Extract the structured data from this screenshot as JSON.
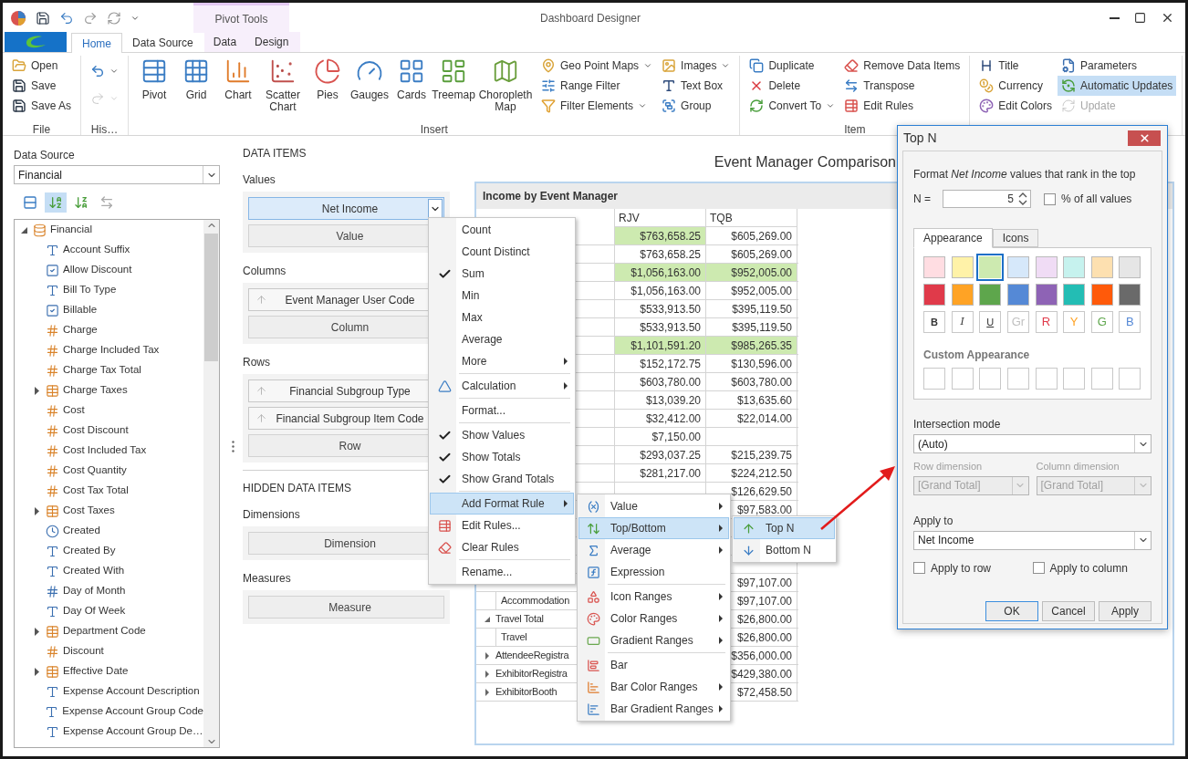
{
  "window": {
    "title": "Dashboard Designer",
    "context_tab_group": "Pivot Tools"
  },
  "ribbon_tabs": [
    {
      "label": "Home",
      "selected": true,
      "contextual": false
    },
    {
      "label": "Data Source",
      "selected": false,
      "contextual": false
    },
    {
      "label": "Data",
      "selected": false,
      "contextual": true
    },
    {
      "label": "Design",
      "selected": false,
      "contextual": true
    }
  ],
  "ribbon_groups": [
    {
      "label": "File",
      "columns": [
        [
          {
            "label": "Open"
          },
          {
            "label": "Save"
          },
          {
            "label": "Save As"
          }
        ]
      ]
    },
    {
      "label": "His…",
      "columns": [
        [
          {
            "dropdown": true,
            "disabled": false
          },
          {
            "dropdown": true,
            "disabled": true
          }
        ]
      ]
    },
    {
      "label": "Insert",
      "large": [
        "Pivot",
        "Grid",
        "Chart",
        "Scatter Chart",
        "Pies",
        "Gauges",
        "Cards",
        "Treemap",
        "Choropleth Map"
      ],
      "columns": [
        [
          {
            "label": "Geo Point Maps",
            "dropdown": true
          },
          {
            "label": "Range Filter"
          },
          {
            "label": "Filter Elements",
            "dropdown": true
          }
        ],
        [
          {
            "label": "Images",
            "dropdown": true
          },
          {
            "label": "Text Box"
          },
          {
            "label": "Group"
          }
        ]
      ]
    },
    {
      "label": "Item",
      "columns": [
        [
          {
            "label": "Duplicate"
          },
          {
            "label": "Delete"
          },
          {
            "label": "Convert To",
            "dropdown": true
          }
        ],
        [
          {
            "label": "Remove Data Items"
          },
          {
            "label": "Transpose"
          },
          {
            "label": "Edit Rules"
          }
        ]
      ]
    },
    {
      "columns": [
        [
          {
            "label": "Title",
            "selected": false,
            "disabled": false
          },
          {
            "label": "Currency",
            "selected": false,
            "disabled": false
          },
          {
            "label": "Edit Colors",
            "selected": false,
            "disabled": false
          }
        ],
        [
          {
            "label": "Parameters",
            "selected": false,
            "disabled": false
          },
          {
            "label": "Automatic Updates",
            "selected": true,
            "disabled": false
          },
          {
            "label": "Update",
            "selected": false,
            "disabled": true
          }
        ]
      ]
    }
  ],
  "fields": {
    "label": "Data Source",
    "source": "Financial",
    "toolbar": [
      {
        "selected": false,
        "disabled": false
      },
      {
        "selected": true,
        "disabled": false
      },
      {
        "selected": false,
        "disabled": false
      },
      {
        "selected": false,
        "disabled": true
      }
    ],
    "tree": [
      {
        "label": "Financial",
        "kind": "source",
        "expanded": true,
        "children": [
          {
            "label": "Account Suffix",
            "kind": "text"
          },
          {
            "label": "Allow Discount",
            "kind": "bool"
          },
          {
            "label": "Bill To Type",
            "kind": "text"
          },
          {
            "label": "Billable",
            "kind": "bool"
          },
          {
            "label": "Charge",
            "kind": "number"
          },
          {
            "label": "Charge Included Tax",
            "kind": "number"
          },
          {
            "label": "Charge Tax Total",
            "kind": "number"
          },
          {
            "label": "Charge Taxes",
            "kind": "table",
            "expanded": false
          },
          {
            "label": "Cost",
            "kind": "number"
          },
          {
            "label": "Cost Discount",
            "kind": "number"
          },
          {
            "label": "Cost Included Tax",
            "kind": "number"
          },
          {
            "label": "Cost Quantity",
            "kind": "number"
          },
          {
            "label": "Cost Tax Total",
            "kind": "number"
          },
          {
            "label": "Cost Taxes",
            "kind": "table",
            "expanded": false
          },
          {
            "label": "Created",
            "kind": "date"
          },
          {
            "label": "Created By",
            "kind": "text"
          },
          {
            "label": "Created With",
            "kind": "text"
          },
          {
            "label": "Day of Month",
            "kind": "integer"
          },
          {
            "label": "Day Of Week",
            "kind": "text"
          },
          {
            "label": "Department Code",
            "kind": "table",
            "expanded": false
          },
          {
            "label": "Discount",
            "kind": "number"
          },
          {
            "label": "Effective Date",
            "kind": "table",
            "expanded": false
          },
          {
            "label": "Expense Account Description",
            "kind": "text"
          },
          {
            "label": "Expense Account Group Code",
            "kind": "text"
          },
          {
            "label": "Expense Account Group De…",
            "kind": "text"
          }
        ]
      }
    ]
  },
  "data_items": {
    "title": "DATA ITEMS",
    "sections": [
      {
        "label": "Values",
        "items": [
          {
            "label": "Net Income",
            "kind": "measure",
            "selected": true
          },
          {
            "label": "Value",
            "kind": "placeholder"
          }
        ]
      },
      {
        "label": "Columns",
        "items": [
          {
            "label": "Event Manager User Code",
            "kind": "dimension",
            "selected": false
          },
          {
            "label": "Column",
            "kind": "placeholder"
          }
        ]
      },
      {
        "label": "Rows",
        "items": [
          {
            "label": "Financial Subgroup Type",
            "kind": "dimension",
            "selected": false
          },
          {
            "label": "Financial Subgroup Item Code",
            "kind": "dimension",
            "selected": false
          },
          {
            "label": "Row",
            "kind": "placeholder"
          }
        ]
      }
    ]
  },
  "hidden_data_items": {
    "title": "HIDDEN DATA ITEMS",
    "sections": [
      {
        "label": "Dimensions",
        "items": [
          {
            "label": "Dimension",
            "kind": "placeholder"
          }
        ]
      },
      {
        "label": "Measures",
        "items": [
          {
            "label": "Measure",
            "kind": "placeholder"
          }
        ]
      }
    ]
  },
  "dashboard": {
    "title": "Event Manager Comparison",
    "pivot": {
      "title": "Income by Event Manager",
      "columns": [
        "RJV",
        "TQB"
      ],
      "rows": [
        {
          "cells": [
            {
              "text": "$763,658.25",
              "highlighted": true
            },
            {
              "text": "$605,269.00",
              "highlighted": false
            }
          ]
        },
        {
          "cells": [
            {
              "text": "$763,658.25",
              "highlighted": false
            },
            {
              "text": "$605,269.00",
              "highlighted": false
            }
          ]
        },
        {
          "cells": [
            {
              "text": "$1,056,163.00",
              "highlighted": true
            },
            {
              "text": "$952,005.00",
              "highlighted": true
            }
          ]
        },
        {
          "cells": [
            {
              "text": "$1,056,163.00",
              "highlighted": false
            },
            {
              "text": "$952,005.00",
              "highlighted": false
            }
          ]
        },
        {
          "cells": [
            {
              "text": "$533,913.50",
              "highlighted": false
            },
            {
              "text": "$395,119.50",
              "highlighted": false
            }
          ]
        },
        {
          "cells": [
            {
              "text": "$533,913.50",
              "highlighted": false
            },
            {
              "text": "$395,119.50",
              "highlighted": false
            }
          ]
        },
        {
          "cells": [
            {
              "text": "$1,101,591.20",
              "highlighted": true
            },
            {
              "text": "$985,265.35",
              "highlighted": true
            }
          ]
        },
        {
          "cells": [
            {
              "text": "$152,172.75",
              "highlighted": false
            },
            {
              "text": "$130,596.00",
              "highlighted": false
            }
          ]
        },
        {
          "cells": [
            {
              "text": "$603,780.00",
              "highlighted": false
            },
            {
              "text": "$603,780.00",
              "highlighted": false
            }
          ]
        },
        {
          "cells": [
            {
              "text": "$13,039.20",
              "highlighted": false
            },
            {
              "text": "$13,635.60",
              "highlighted": false
            }
          ]
        },
        {
          "cells": [
            {
              "text": "$32,412.00",
              "highlighted": false
            },
            {
              "text": "$22,014.00",
              "highlighted": false
            }
          ]
        },
        {
          "cells": [
            {
              "text": "$7,150.00",
              "highlighted": false
            },
            null
          ]
        },
        {
          "cells": [
            {
              "text": "$293,037.25",
              "highlighted": false
            },
            {
              "text": "$215,239.75",
              "highlighted": false
            }
          ]
        },
        {
          "cells": [
            {
              "text": "$281,217.00",
              "highlighted": false
            },
            {
              "text": "$224,212.50",
              "highlighted": false
            }
          ]
        },
        {
          "cells": [
            null,
            {
              "text": "$126,629.50",
              "highlighted": false
            }
          ]
        },
        {
          "cells": [
            null,
            {
              "text": "$97,583.00",
              "highlighted": false
            }
          ]
        },
        {
          "cells": [
            null,
            null
          ]
        },
        {
          "cells": [
            null,
            null
          ]
        },
        {
          "cells": [
            null,
            null
          ]
        },
        {
          "cells": [
            null,
            {
              "text": "$97,107.00",
              "highlighted": false
            }
          ]
        },
        {
          "label": "Accommodation",
          "kind": "child",
          "cells": [
            null,
            {
              "text": "$97,107.00",
              "highlighted": false
            }
          ]
        },
        {
          "label": "Travel Total",
          "kind": "expanded",
          "cells": [
            null,
            {
              "text": "$26,800.00",
              "highlighted": false
            }
          ]
        },
        {
          "label": "Travel",
          "kind": "child",
          "cells": [
            null,
            {
              "text": "$26,800.00",
              "highlighted": false
            }
          ]
        },
        {
          "label": "AttendeeRegistra",
          "kind": "collapsed",
          "cells": [
            null,
            {
              "text": "$356,000.00",
              "highlighted": false
            }
          ]
        },
        {
          "label": "ExhibitorRegistra",
          "kind": "collapsed",
          "cells": [
            null,
            {
              "text": "$429,380.00",
              "highlighted": false
            }
          ]
        },
        {
          "label": "ExhibitorBooth",
          "kind": "collapsed",
          "cells": [
            null,
            {
              "text": "$72,458.50",
              "highlighted": false
            }
          ]
        }
      ]
    }
  },
  "menus": [
    {
      "items": [
        {
          "kind": "item",
          "label": "Count",
          "checked": false,
          "submenu": false,
          "selected": false
        },
        {
          "kind": "item",
          "label": "Count Distinct",
          "checked": false,
          "submenu": false,
          "selected": false
        },
        {
          "kind": "item",
          "label": "Sum",
          "checked": true,
          "submenu": false,
          "selected": false
        },
        {
          "kind": "item",
          "label": "Min",
          "checked": false,
          "submenu": false,
          "selected": false
        },
        {
          "kind": "item",
          "label": "Max",
          "checked": false,
          "submenu": false,
          "selected": false
        },
        {
          "kind": "item",
          "label": "Average",
          "checked": false,
          "submenu": false,
          "selected": false
        },
        {
          "kind": "item",
          "label": "More",
          "checked": false,
          "submenu": true,
          "selected": false
        },
        {
          "kind": "separator"
        },
        {
          "kind": "item",
          "label": "Calculation",
          "checked": false,
          "submenu": true,
          "selected": false
        },
        {
          "kind": "separator"
        },
        {
          "kind": "item",
          "label": "Format...",
          "checked": false,
          "submenu": false,
          "selected": false
        },
        {
          "kind": "separator"
        },
        {
          "kind": "item",
          "label": "Show Values",
          "checked": true,
          "submenu": false,
          "selected": false
        },
        {
          "kind": "item",
          "label": "Show Totals",
          "checked": true,
          "submenu": false,
          "selected": false
        },
        {
          "kind": "item",
          "label": "Show Grand Totals",
          "checked": true,
          "submenu": false,
          "selected": false
        },
        {
          "kind": "separator"
        },
        {
          "kind": "item",
          "label": "Add Format Rule",
          "checked": false,
          "submenu": true,
          "selected": true
        },
        {
          "kind": "item",
          "label": "Edit Rules...",
          "checked": false,
          "submenu": false,
          "selected": false
        },
        {
          "kind": "item",
          "label": "Clear Rules",
          "checked": false,
          "submenu": false,
          "selected": false
        },
        {
          "kind": "separator"
        },
        {
          "kind": "item",
          "label": "Rename...",
          "checked": false,
          "submenu": false,
          "selected": false
        }
      ]
    },
    {
      "items": [
        {
          "kind": "item",
          "label": "Value",
          "submenu": true,
          "selected": false
        },
        {
          "kind": "item",
          "label": "Top/Bottom",
          "submenu": true,
          "selected": true
        },
        {
          "kind": "item",
          "label": "Average",
          "submenu": true,
          "selected": false
        },
        {
          "kind": "item",
          "label": "Expression",
          "submenu": false,
          "selected": false
        },
        {
          "kind": "separator"
        },
        {
          "kind": "item",
          "label": "Icon Ranges",
          "submenu": true,
          "selected": false
        },
        {
          "kind": "item",
          "label": "Color Ranges",
          "submenu": true,
          "selected": false
        },
        {
          "kind": "item",
          "label": "Gradient Ranges",
          "submenu": true,
          "selected": false
        },
        {
          "kind": "separator"
        },
        {
          "kind": "item",
          "label": "Bar",
          "submenu": false,
          "selected": false
        },
        {
          "kind": "item",
          "label": "Bar Color Ranges",
          "submenu": true,
          "selected": false
        },
        {
          "kind": "item",
          "label": "Bar Gradient Ranges",
          "submenu": true,
          "selected": false
        }
      ]
    },
    {
      "items": [
        {
          "kind": "item",
          "label": "Top N",
          "submenu": false,
          "selected": true
        },
        {
          "kind": "item",
          "label": "Bottom N",
          "submenu": false,
          "selected": false
        }
      ]
    }
  ],
  "dialog": {
    "title": "Top N",
    "description": "Format *Net Income* values that rank in the top",
    "n_label": "N =",
    "n_value": "5",
    "percent_checkbox": {
      "label": "% of all values",
      "checked": false
    },
    "tabs": [
      {
        "label": "Appearance",
        "selected": true
      },
      {
        "label": "Icons",
        "selected": false
      }
    ],
    "swatches": [
      {
        "color": "#ffdde2",
        "selected": false
      },
      {
        "color": "#fff2a8",
        "selected": false
      },
      {
        "color": "#cdeab0",
        "selected": true
      },
      {
        "color": "#d6e8fa",
        "selected": false
      },
      {
        "color": "#f0dcf5",
        "selected": false
      },
      {
        "color": "#c6f2ee",
        "selected": false
      },
      {
        "color": "#fde0b0",
        "selected": false
      },
      {
        "color": "#e6e6e6",
        "selected": false
      },
      {
        "color": "#e03a4a",
        "selected": false
      },
      {
        "color": "#ffa325",
        "selected": false
      },
      {
        "color": "#5ea64c",
        "selected": false
      },
      {
        "color": "#5589d6",
        "selected": false
      },
      {
        "color": "#8e63b5",
        "selected": false
      },
      {
        "color": "#23bdb4",
        "selected": false
      },
      {
        "color": "#ff5a0a",
        "selected": false
      },
      {
        "color": "#6a6a6a",
        "selected": false
      }
    ],
    "text_styles": [
      {
        "label": "B",
        "kind": "bold"
      },
      {
        "label": "I",
        "kind": "italic"
      },
      {
        "label": "U",
        "kind": "underline"
      },
      {
        "label": "Gr",
        "kind": "color",
        "color": "#c0c0c0"
      },
      {
        "label": "R",
        "kind": "color",
        "color": "#e03a4a"
      },
      {
        "label": "Y",
        "kind": "color",
        "color": "#ffa325"
      },
      {
        "label": "G",
        "kind": "color",
        "color": "#5ea64c"
      },
      {
        "label": "B",
        "kind": "color",
        "color": "#5589d6"
      }
    ],
    "custom_appearance_label": "Custom Appearance",
    "intersection_mode": {
      "label": "Intersection mode",
      "value": "(Auto)",
      "disabled": false
    },
    "row_dimension": {
      "label": "Row dimension",
      "value": "[Grand Total]",
      "disabled": true
    },
    "column_dimension": {
      "label": "Column dimension",
      "value": "[Grand Total]",
      "disabled": true
    },
    "apply_to": {
      "label": "Apply to",
      "value": "Net Income",
      "disabled": false
    },
    "checkboxes": [
      {
        "label": "Apply to row",
        "checked": false
      },
      {
        "label": "Apply to column",
        "checked": false
      }
    ],
    "buttons": [
      {
        "label": "OK",
        "default": true
      },
      {
        "label": "Cancel",
        "default": false
      },
      {
        "label": "Apply",
        "default": false
      }
    ]
  }
}
